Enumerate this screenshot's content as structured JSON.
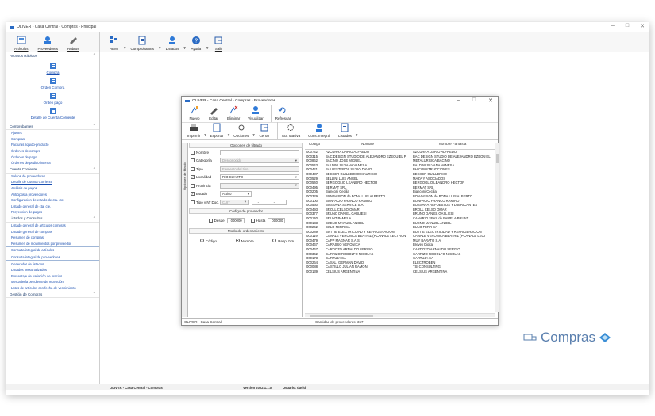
{
  "app": {
    "title": "OLIVER - Casa Central - Compras - Principal",
    "window_controls": [
      "–",
      "□",
      "✕"
    ]
  },
  "ribbon": {
    "buttons": [
      {
        "label": "Artículos",
        "icon": "articles-icon"
      },
      {
        "label": "Proveedores",
        "icon": "suppliers-icon"
      },
      {
        "label": "Rubros",
        "icon": "categories-icon"
      },
      {
        "label": "ABM",
        "icon": "abm-icon"
      },
      {
        "label": "Comprobantes",
        "icon": "vouchers-icon"
      },
      {
        "label": "Listados",
        "icon": "reports-icon"
      },
      {
        "label": "Ayuda",
        "icon": "help-icon"
      },
      {
        "label": "Salir",
        "icon": "exit-icon"
      }
    ]
  },
  "sidebar": {
    "sections": [
      {
        "title": "Accesos Rápidos"
      },
      {
        "title": "Comprobantes"
      },
      {
        "title": "Cuenta Corriente"
      },
      {
        "title": "Listados y Consultas"
      },
      {
        "title": "Gestión de Compras"
      }
    ],
    "quick_access": [
      "Compra",
      "Orden Compra",
      "Orden pago",
      "Detalle de Cuenta Corriente"
    ],
    "comprobantes": [
      "Ajustes",
      "Compras",
      "Facturas líquido-producto",
      "Órdenes de compra",
      "Órdenes de pago",
      "Órdenes de pedido interna"
    ],
    "cuenta_corriente": [
      "Saldos de proveedores",
      "Detalle de Cuenta Corriente",
      "Análisis de pagos",
      "Anticipos a proveedores",
      "Configuración de estado de cta. cte.",
      "Listado general de cta. cte.",
      "Proyección de pagos"
    ],
    "listados": [
      "Listado general de artículos compras",
      "Listado general de compras",
      "Resumen de compras",
      "Resumen de movimientos por proveedor",
      "Consulta integral de artículos",
      "Consulta integral de proveedores",
      "Generador de listados",
      "Listados personalizados",
      "Porcentaje de variación de precios",
      "Mercadería pendiente de recepción",
      "Lotes de artículos con fecha de vencimiento"
    ]
  },
  "statusbar": {
    "left": "OLIVER - Casa Central - Compras",
    "version": "Versión 2022.1.1.0",
    "user": "Usuario: david"
  },
  "brand": {
    "text": "Compras"
  },
  "proveedores_window": {
    "title": "OLIVER - Casa Central - Compras - Proveedores",
    "toolbar1": [
      "Nuevo",
      "Editar",
      "Eliminar",
      "Visualizar",
      "Refrescar"
    ],
    "toolbar2": [
      "Imprimir",
      "Exportar",
      "Opciones",
      "Cerrar",
      "Act. Masiva",
      "Cons. Integral",
      "Listados"
    ],
    "vtab": "Opciones de filtrado",
    "filter_header": "Opciones de filtrado",
    "filters": {
      "nombre": {
        "label": "Nombre",
        "value": ""
      },
      "categoria": {
        "label": "Categoría",
        "value": "Desconocido"
      },
      "tipo": {
        "label": "Tipo",
        "value": "Elemento del tipo"
      },
      "localidad": {
        "label": "Localidad",
        "value": "RÍO CUARTO"
      },
      "provincia": {
        "label": "Provincia",
        "value": ""
      },
      "estado": {
        "label": "Estado",
        "value": "Activo"
      },
      "tipo_doc": {
        "label": "Tipo y Nº Doc.",
        "value": "CUIT",
        "number": "__-________-_"
      }
    },
    "codigo_header": "Código de proveedor",
    "desde": {
      "label": "Desde",
      "value": "000000"
    },
    "hasta": {
      "label": "Hasta",
      "value": "000000"
    },
    "orden_header": "Modo de ordenamiento",
    "orden": [
      "Código",
      "Nombre",
      "Resp. IVA"
    ],
    "grid_headers": [
      "Código",
      "Nombre",
      "Nombre Fantasía"
    ],
    "rows": [
      [
        "000742",
        "AZCURRA DARIO ALFREDO",
        "AZCURRA DARIO ALFREDO"
      ],
      [
        "000315",
        "BAC DESIGN STUDIO DE ALEJANDRO EZEQUIEL P",
        "BAC DESIGN STUDIO DE ALEJANDRO EZEQUIEL"
      ],
      [
        "000862",
        "BACINO JOSE MIGUEL",
        "METALURGICA BACINO"
      ],
      [
        "000543",
        "BALDINI SILVANA VANESA",
        "BALDINI SILVANA VANESA"
      ],
      [
        "000421",
        "BALLESTEROS SILVIO DAVID",
        "BH CONSTRUCCIONES"
      ],
      [
        "000437",
        "BECKER GUILLERMO MAURICIO",
        "BECKER GUILLERMO"
      ],
      [
        "000529",
        "BELLINI LUIS ANGEL",
        "MAZA Y ASOCIADOS"
      ],
      [
        "000540",
        "BERGOGLIO LEANDRO HECTOR",
        "BERGOGLIO LEANDRO HECTOR"
      ],
      [
        "000495",
        "BERMAT SRL",
        "BERMAT SRL"
      ],
      [
        "000205",
        "Bianconi Cecilia",
        "Bianconi Cecilia"
      ],
      [
        "000329",
        "BONAVISION de BONA LUIS ALBERTO",
        "BONAVISION de BONA LUIS ALBERTO"
      ],
      [
        "000100",
        "BONFACIO FRANCO RAMIRO",
        "BONFACIO FRANCO RAMIRO"
      ],
      [
        "000560",
        "BOSSANA SERVICE S.A.",
        "BOSSANA REPUESTOS Y LUBRICANTES"
      ],
      [
        "000493",
        "BROLL CELSO OMAR",
        "BROLL CELSO OMAR"
      ],
      [
        "000377",
        "BRUNO DANIEL GASLIESI",
        "BRUNO DANIEL GASLIESI"
      ],
      [
        "000140",
        "BRUNT PAMELA",
        "CANARIO SPAS de PAMELA BRUNT"
      ],
      [
        "000133",
        "BUENO MANUEL ANGEL",
        "BUENO MANUEL ANGEL"
      ],
      [
        "000262",
        "BULO FERR SA",
        "BULO FERR SA"
      ],
      [
        "000289",
        "BUTTIE ELECTRICIDAD Y REFRIGERACION",
        "BUTTIE ELECTRICIDAD Y REFRIGERACION"
      ],
      [
        "000119",
        "CANALE VERONICA BEATRIZ (PCANALE LECTRON",
        "CANALE VERONICA BEATRIZ (PCANALE LECT"
      ],
      [
        "000479",
        "CAPP MAGNAR S.A.S.",
        "MUY BARATO S.A."
      ],
      [
        "000467",
        "CARASSO VERONICA",
        "Brevex Digital"
      ],
      [
        "000467",
        "CARDOZO ARNALDO SERGIO",
        "CARDOZO ARNALDO SERGIO"
      ],
      [
        "000362",
        "CARRIZO RODOLFO NICOLAS",
        "CARRIZO RODOLFO NICOLAS"
      ],
      [
        "000173",
        "CARTUJA SA",
        "CARTUJA SA"
      ],
      [
        "000264",
        "CASALI GERMAN DAVID",
        "ELECTROBEN"
      ],
      [
        "000088",
        "CASTILLO JULIAN RAMON",
        "TSI CONSULTING"
      ],
      [
        "000139",
        "CELSIUS ARGENTINA",
        "CELSIUS ARGENTINA"
      ]
    ],
    "status_left": "OLIVER - Casa Central",
    "status_count": "Cantidad de proveedores: 367"
  },
  "colors": {
    "accent": "#1a4fb0",
    "brand": "#5a7fae"
  }
}
